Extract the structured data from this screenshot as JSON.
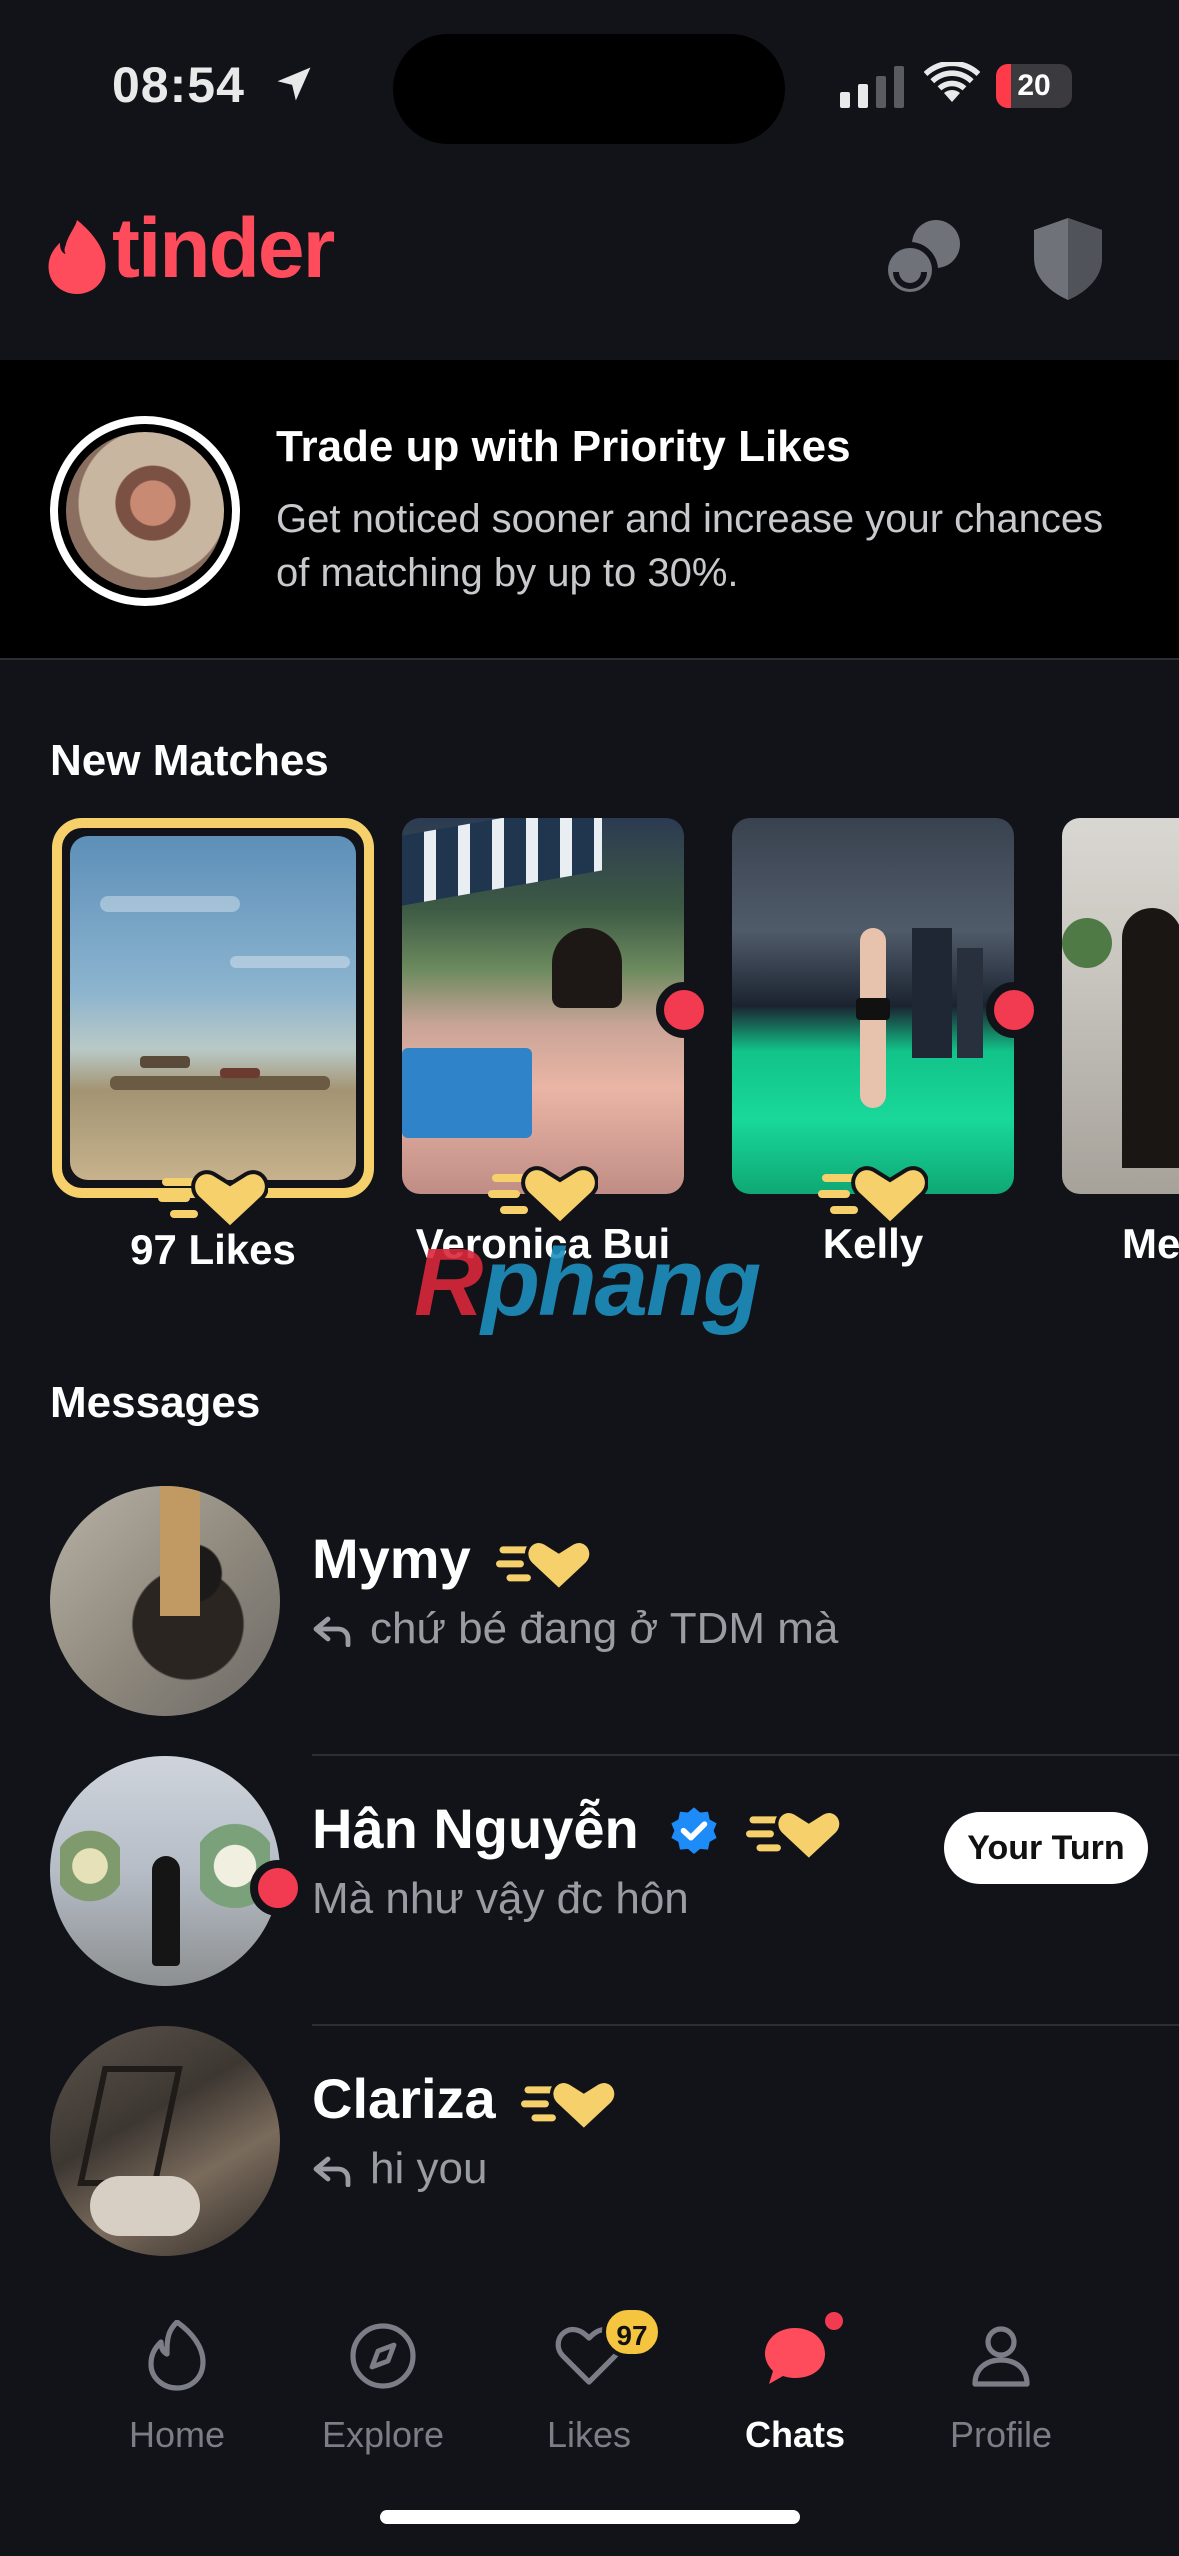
{
  "status_bar": {
    "time": "08:54",
    "battery": "20",
    "battery_level": 0.2
  },
  "header": {
    "logo": "tinder",
    "icons": [
      "double-date-icon",
      "shield-icon"
    ]
  },
  "promo": {
    "title": "Trade up with Priority Likes",
    "subtitle": "Get noticed sooner and increase your chances of matching by up to 30%."
  },
  "new_matches": {
    "title": "New Matches",
    "items": [
      {
        "label": "97 Likes"
      },
      {
        "label": "Veronica Bui"
      },
      {
        "label": "Kelly"
      },
      {
        "label": "Me"
      }
    ]
  },
  "watermark": {
    "first": "R",
    "rest": "phang"
  },
  "messages": {
    "title": "Messages",
    "items": [
      {
        "name": "Mymy",
        "preview": "chứ bé đang ở TDM mà",
        "replied": true
      },
      {
        "name": "Hân Nguyễn",
        "preview": "Mà như vậy đc hôn",
        "verified": true,
        "badge": "Your Turn"
      },
      {
        "name": "Clariza",
        "preview": "hi you",
        "replied": true
      }
    ]
  },
  "tabbar": {
    "tabs": [
      {
        "label": "Home",
        "icon": "tinder-flame-icon"
      },
      {
        "label": "Explore",
        "icon": "compass-icon"
      },
      {
        "label": "Likes",
        "icon": "heart-icon",
        "count": "97"
      },
      {
        "label": "Chats",
        "icon": "chat-bubble-icon",
        "active": true
      },
      {
        "label": "Profile",
        "icon": "person-icon"
      }
    ]
  },
  "colors": {
    "brand": "#fe4c5c",
    "gold": "#f6d06b",
    "online": "#f23a50",
    "verified": "#1d8cf8"
  }
}
